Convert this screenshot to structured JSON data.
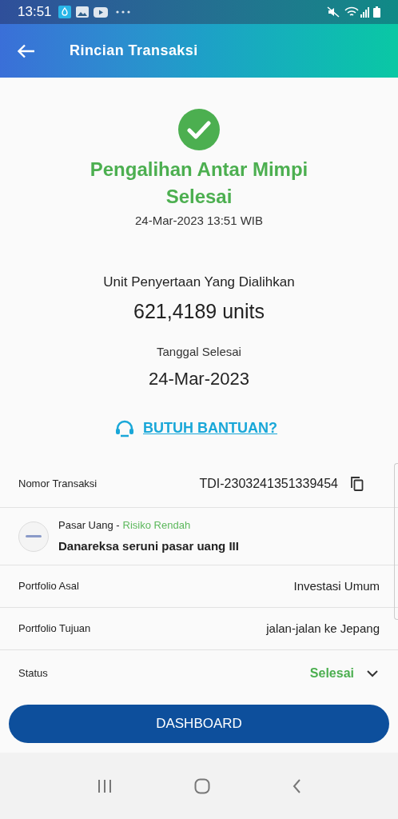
{
  "status_bar": {
    "time": "13:51"
  },
  "header": {
    "title": "Rincian Transaksi"
  },
  "result": {
    "title": "Pengalihan Antar Mimpi Selesai",
    "datetime": "24-Mar-2023 13:51 WIB"
  },
  "units": {
    "label": "Unit Penyertaan Yang Dialihkan",
    "value": "621,4189 units"
  },
  "completion": {
    "label": "Tanggal Selesai",
    "value": "24-Mar-2023"
  },
  "help_link": "BUTUH BANTUAN?",
  "details": [
    {
      "kind": "copy",
      "label": "Nomor Transaksi",
      "value": "TDI-2303241351339454"
    },
    {
      "kind": "fund",
      "category": "Pasar Uang -",
      "risk": "Risiko Rendah",
      "name": "Danareksa seruni pasar uang III"
    },
    {
      "kind": "plain",
      "label": "Portfolio Asal",
      "value": "Investasi Umum"
    },
    {
      "kind": "plain",
      "label": "Portfolio Tujuan",
      "value": "jalan-jalan ke Jepang"
    },
    {
      "kind": "status",
      "label": "Status",
      "value": "Selesai",
      "expanded": false
    }
  ],
  "button": "DASHBOARD"
}
